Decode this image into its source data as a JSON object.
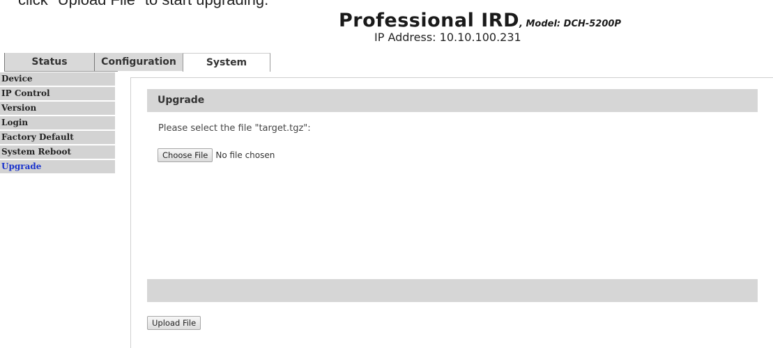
{
  "caption": "click \"Upload File\" to start upgrading.",
  "header": {
    "title": "Professional IRD",
    "model": ", Model: DCH-5200P",
    "ip_label": "IP Address: 10.10.100.231"
  },
  "tabs": [
    "Status",
    "Configuration",
    "System"
  ],
  "active_tab": "System",
  "sidebar": {
    "items": [
      {
        "label": "Device"
      },
      {
        "label": "IP Control"
      },
      {
        "label": "Version"
      },
      {
        "label": "Login"
      },
      {
        "label": "Factory Default"
      },
      {
        "label": "System Reboot"
      },
      {
        "label": "Upgrade"
      }
    ],
    "active": "Upgrade"
  },
  "panel": {
    "heading": "Upgrade",
    "prompt": "Please select the file \"target.tgz\":",
    "choose_file_label": "Choose File",
    "no_file_text": "No file chosen",
    "upload_label": "Upload File"
  },
  "colors": {
    "sidebar_bg": "#d3d3d3",
    "active_link": "#1a33cc",
    "panel_header_bg": "#d6d6d6"
  }
}
